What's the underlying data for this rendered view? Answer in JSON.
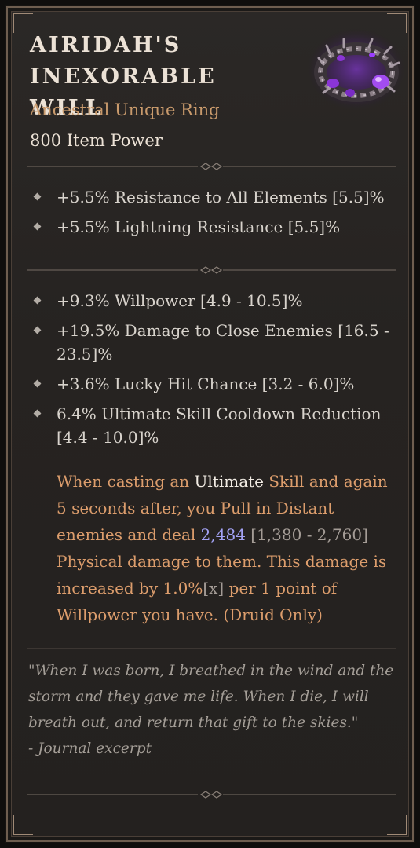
{
  "item": {
    "name_line1": "AIRIDAH'S",
    "name_line2": "INEXORABLE WILL",
    "type": "Ancestral Unique Ring",
    "item_power": "800 Item Power",
    "icon": "purple-thorned-ring-icon"
  },
  "implicit_affixes": [
    {
      "text": "+5.5% Resistance to All Elements [5.5]%"
    },
    {
      "text": "+5.5% Lightning Resistance [5.5]%"
    }
  ],
  "affixes": [
    {
      "text": "+9.3% Willpower [4.9 - 10.5]%"
    },
    {
      "text": "+19.5% Damage to Close Enemies [16.5 - 23.5]%"
    },
    {
      "text": "+3.6% Lucky Hit Chance [3.2 - 6.0]%"
    },
    {
      "text": "6.4% Ultimate Skill Cooldown Reduction [4.4 - 10.0]%"
    }
  ],
  "unique_power": {
    "p1": "When casting an ",
    "kw1": "Ultimate",
    "p2": " Skill and again 5 seconds after, you Pull in Distant enemies and deal ",
    "damage": "2,484",
    "damage_range": " [1,380 - 2,760]",
    "p3": " Physical damage to them. This damage is increased by 1.0%",
    "multiplier_tag": "[x]",
    "p4": " per 1 point of Willpower you have. (Druid Only)"
  },
  "flavor": {
    "quote": "\"When I was born, I breathed in the wind and the storm and they gave me life. When I die, I will breath out, and return that gift to the skies.\"",
    "attribution": "- Journal excerpt"
  },
  "colors": {
    "title": "#ece2d6",
    "unique_orange": "#dc9d6c",
    "damage_value": "#a3a2f4",
    "text": "#d8d3cc",
    "flavor": "#a49e97"
  }
}
